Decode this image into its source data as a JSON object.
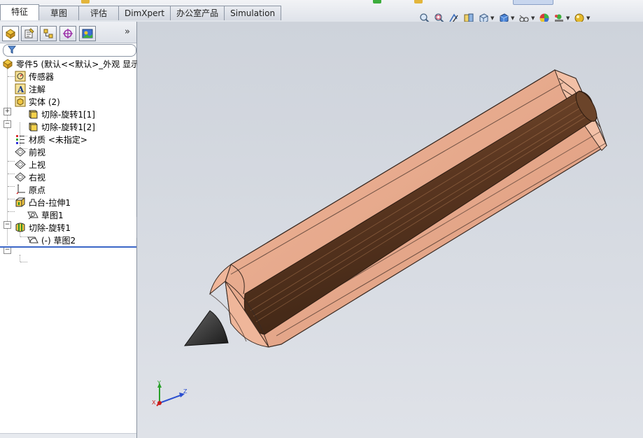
{
  "cmd_tabs": [
    {
      "label": "特征",
      "active": true
    },
    {
      "label": "草图",
      "active": false
    },
    {
      "label": "评估",
      "active": false
    },
    {
      "label": "DimXpert",
      "active": false
    },
    {
      "label": "办公室产品",
      "active": false
    },
    {
      "label": "Simulation",
      "active": false
    }
  ],
  "view_toolbar_icons": [
    "zoom-to-fit-icon",
    "zoom-to-area-icon",
    "previous-view-icon",
    "section-view-icon",
    "view-orientation-icon",
    "display-style-icon",
    "hide-show-items-icon",
    "edit-appearance-icon",
    "apply-scene-icon",
    "view-settings-icon"
  ],
  "feature_manager_tabs": [
    "featuremanager-icon",
    "propertymanager-icon",
    "configurationmanager-icon",
    "dimxpertmanager-icon",
    "displaymanager-icon"
  ],
  "tree": {
    "root_label": "零件5  (默认<<默认>_外观 显示",
    "sensors": "传感器",
    "annotations": "注解",
    "solid_bodies": "实体 (2)",
    "body_1": "切除-旋转1[1]",
    "body_2": "切除-旋转1[2]",
    "material": "材质 <未指定>",
    "front_plane": "前视",
    "top_plane": "上视",
    "right_plane": "右视",
    "origin": "原点",
    "boss_extrude": "凸台-拉伸1",
    "sketch1": "草图1",
    "cut_revolve": "切除-旋转1",
    "sketch2": "(-) 草图2"
  },
  "triad": {
    "x": "X",
    "y": "Y",
    "z": "Z"
  },
  "colors": {
    "viewport_bg": "#d3d7de",
    "wood": "#e8a98c",
    "lead": "#5e3a22",
    "tip": "#2e2e30",
    "tab_active": "#ffffff",
    "tree_end_line": "#3b67c7"
  }
}
